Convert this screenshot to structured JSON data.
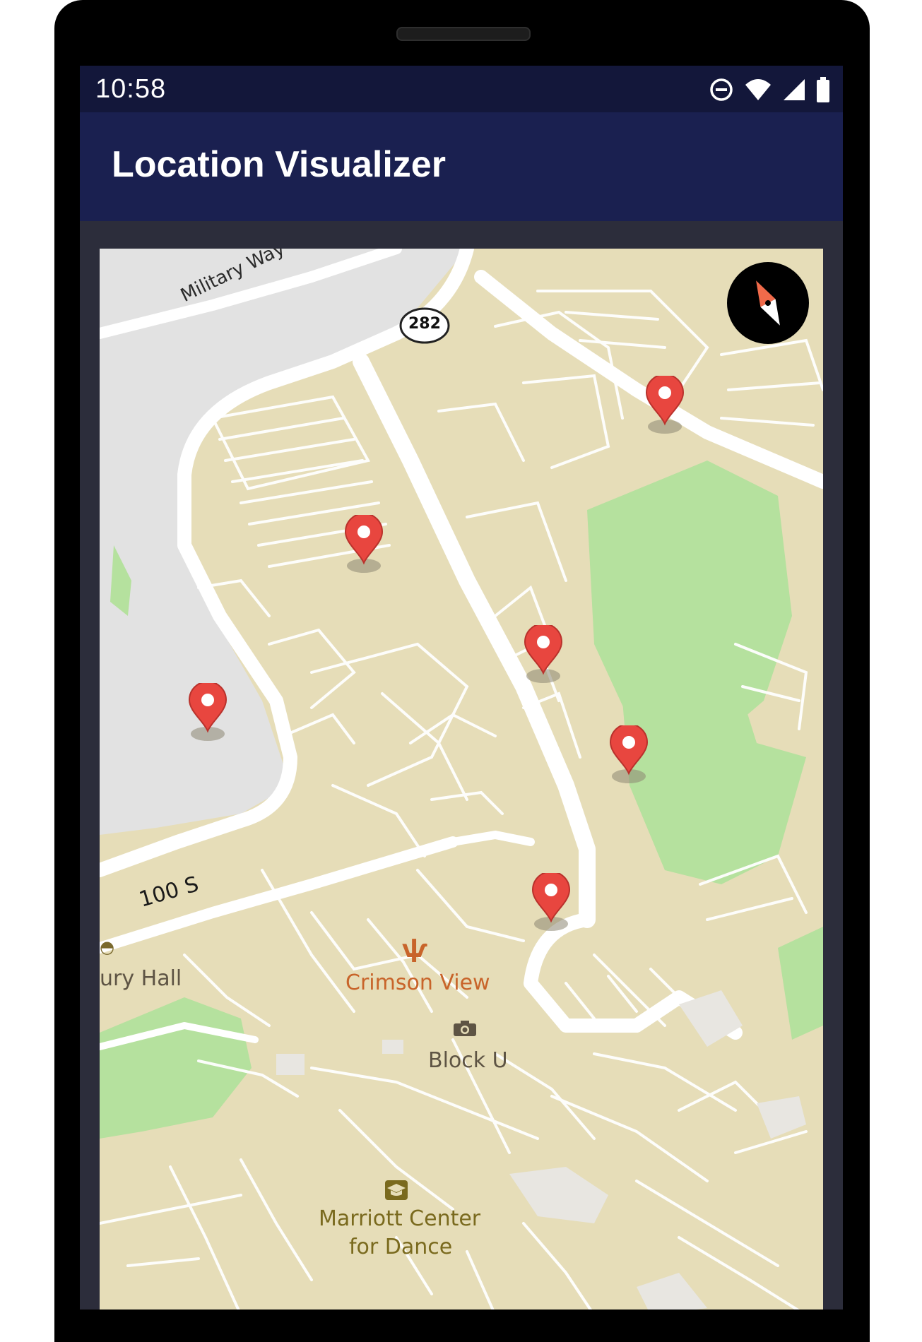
{
  "status_bar": {
    "time": "10:58",
    "icons": [
      "do-not-disturb-icon",
      "wifi-icon",
      "cell-signal-icon",
      "battery-icon"
    ]
  },
  "app_bar": {
    "title": "Location Visualizer",
    "background": "#1a2050"
  },
  "map": {
    "road_labels": {
      "military_way": "Military Way",
      "route_282": "282",
      "street_100s": "100 S"
    },
    "poi_labels": {
      "crimson_view": "Crimson View",
      "block_u": "Block U",
      "marriott_line1": "Marriott Center",
      "marriott_line2": "for Dance",
      "hall_partial": "ury Hall"
    },
    "markers": [
      {
        "name": "location-marker-1"
      },
      {
        "name": "location-marker-2"
      },
      {
        "name": "location-marker-3"
      },
      {
        "name": "location-marker-4"
      },
      {
        "name": "location-marker-5"
      },
      {
        "name": "location-marker-6"
      }
    ],
    "colors": {
      "land": "#e6ddb8",
      "road": "#ffffff",
      "park": "#b5e19e",
      "restricted": "#e2e2e2",
      "marker": "#e8463f",
      "poi_food": "#c8642a",
      "poi_generic": "#5e5444",
      "poi_education": "#7a6a1e"
    }
  }
}
